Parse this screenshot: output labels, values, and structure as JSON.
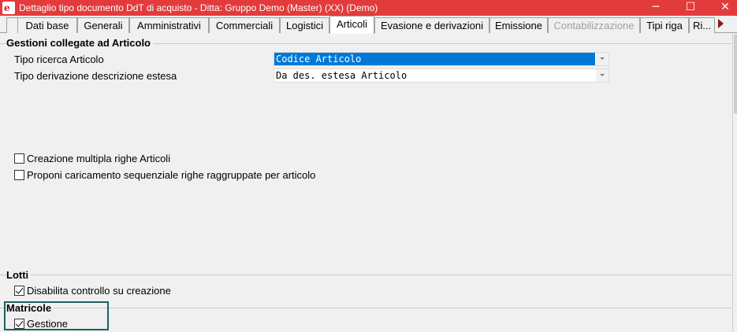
{
  "window": {
    "title": "Dettaglio tipo documento DdT di acquisto - Ditta: Gruppo Demo (Master) (XX)  (Demo)",
    "app_icon": "app-logo-icon",
    "controls": {
      "minimize": "─",
      "maximize": "☐",
      "close": "✕"
    }
  },
  "tabs": [
    {
      "label": "Dati base"
    },
    {
      "label": "Generali"
    },
    {
      "label": "Amministrativi"
    },
    {
      "label": "Commerciali"
    },
    {
      "label": "Logistici"
    },
    {
      "label": "Articoli",
      "active": true
    },
    {
      "label": "Evasione e derivazioni"
    },
    {
      "label": "Emissione"
    },
    {
      "label": "Contabilizzazione",
      "disabled": true
    },
    {
      "label": "Tipi riga"
    },
    {
      "label": "Ri..."
    }
  ],
  "articoli_group": {
    "title": "Gestioni collegate ad Articolo",
    "tipo_ricerca": {
      "label": "Tipo ricerca Articolo",
      "value": "Codice Articolo"
    },
    "tipo_derivazione": {
      "label": "Tipo derivazione descrizione estesa",
      "value": "Da des. estesa Articolo"
    },
    "creazione_multipla": {
      "label": "Creazione multipla righe Articoli",
      "checked": false
    },
    "caricamento_sequenziale": {
      "label": "Proponi caricamento sequenziale righe raggruppate per articolo",
      "checked": false
    }
  },
  "lotti_group": {
    "title": "Lotti",
    "disabilita_controllo": {
      "label": "Disabilita controllo su creazione",
      "checked": true
    }
  },
  "matricole_group": {
    "title": "Matricole",
    "gestione": {
      "label": "Gestione",
      "checked": true
    }
  },
  "colors": {
    "titlebar": "#e33b3b",
    "selection": "#0078d7",
    "highlight": "#1f5f5f"
  }
}
